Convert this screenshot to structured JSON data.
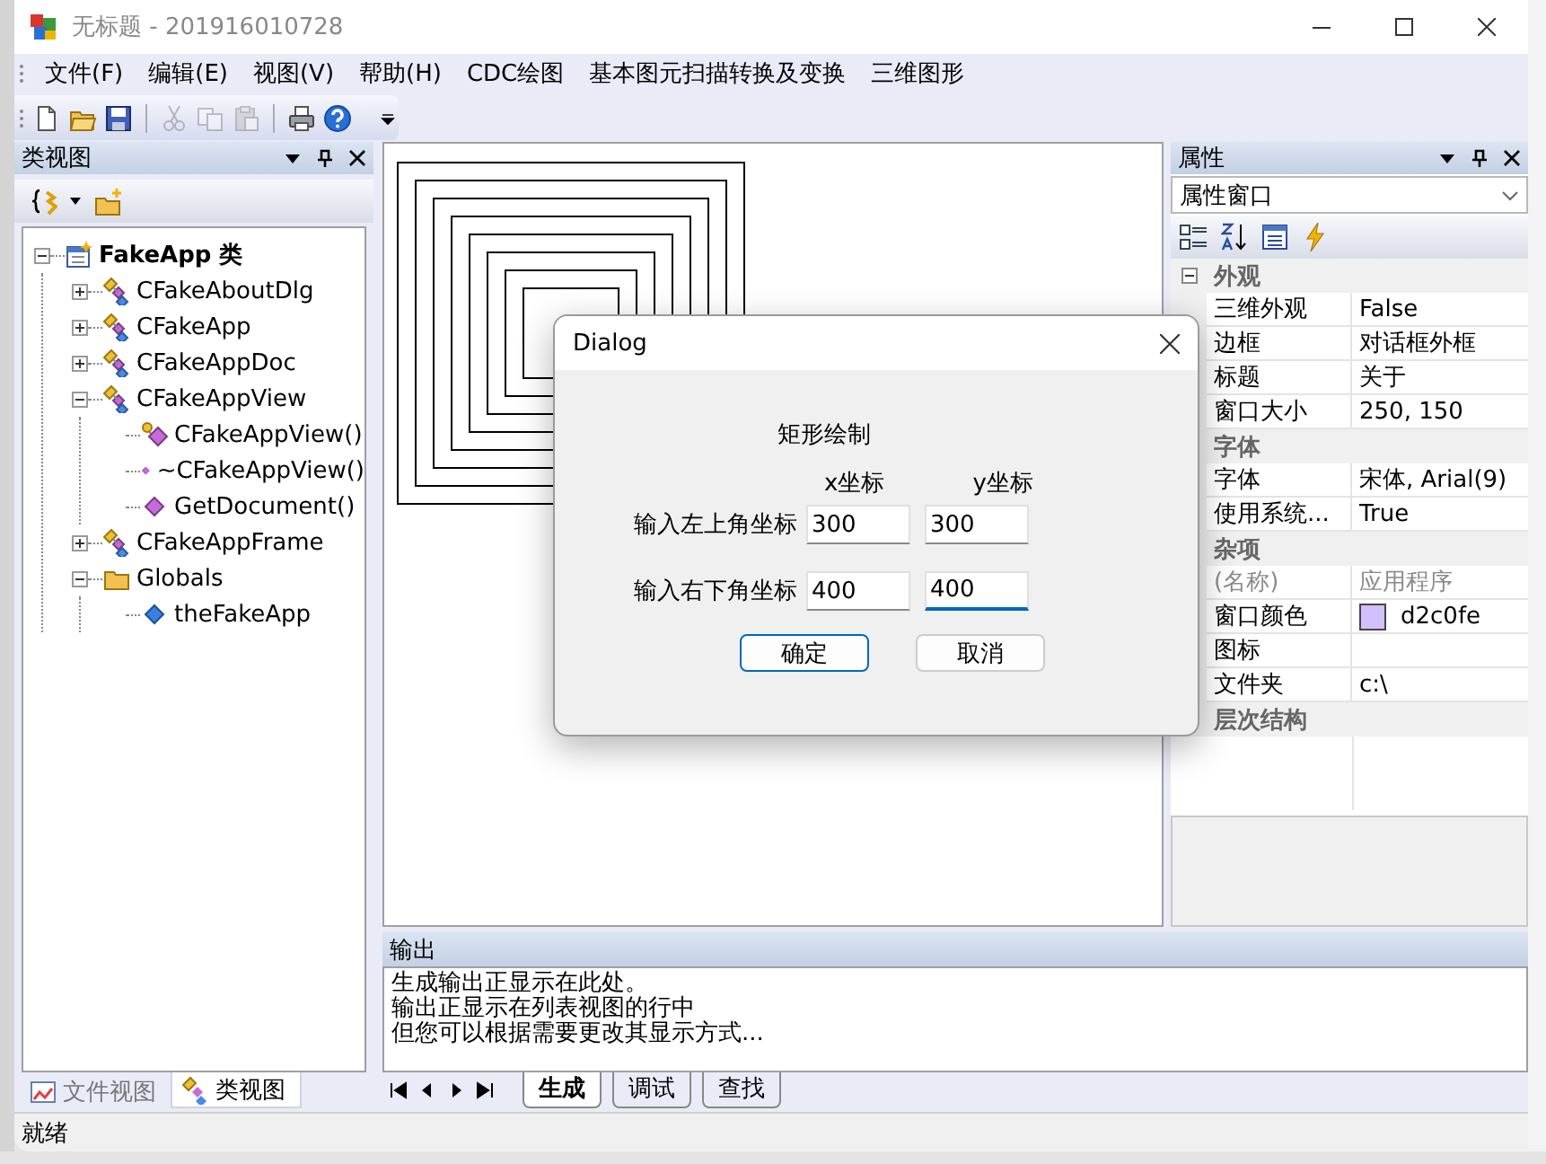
{
  "window": {
    "title": "无标题 - 201916010728"
  },
  "menu": [
    {
      "label": "文件(F)"
    },
    {
      "label": "编辑(E)"
    },
    {
      "label": "视图(V)"
    },
    {
      "label": "帮助(H)"
    },
    {
      "label": "CDC绘图"
    },
    {
      "label": "基本图元扫描转换及变换"
    },
    {
      "label": "三维图形"
    }
  ],
  "toolbar": [
    {
      "kind": "new",
      "disabled": false
    },
    {
      "kind": "open",
      "disabled": false
    },
    {
      "kind": "save",
      "disabled": false
    },
    {
      "kind": "separator"
    },
    {
      "kind": "cut",
      "disabled": true
    },
    {
      "kind": "copy",
      "disabled": true
    },
    {
      "kind": "paste",
      "disabled": true
    },
    {
      "kind": "separator"
    },
    {
      "kind": "print",
      "disabled": false
    },
    {
      "kind": "help",
      "disabled": false
    }
  ],
  "class_view": {
    "title": "类视图",
    "tree": [
      {
        "kind": "project",
        "label": "FakeApp 类",
        "expanded": true,
        "children": [
          {
            "kind": "class",
            "label": "CFakeAboutDlg",
            "expanded": false
          },
          {
            "kind": "class",
            "label": "CFakeApp",
            "expanded": false
          },
          {
            "kind": "class",
            "label": "CFakeAppDoc",
            "expanded": false
          },
          {
            "kind": "class",
            "label": "CFakeAppView",
            "expanded": true,
            "children": [
              {
                "kind": "constructor",
                "label": "CFakeAppView()"
              },
              {
                "kind": "method",
                "label": "~CFakeAppView()"
              },
              {
                "kind": "method",
                "label": "GetDocument()"
              }
            ]
          },
          {
            "kind": "class",
            "label": "CFakeAppFrame",
            "expanded": false
          },
          {
            "kind": "folder",
            "label": "Globals",
            "expanded": true,
            "children": [
              {
                "kind": "variable",
                "label": "theFakeApp"
              }
            ]
          }
        ]
      }
    ],
    "tabs": [
      {
        "label": "文件视图",
        "selected": false
      },
      {
        "label": "类视图",
        "selected": true
      }
    ]
  },
  "properties": {
    "title": "属性",
    "selector": "属性窗口",
    "groups": [
      {
        "name": "外观",
        "expanded": true,
        "rows": [
          {
            "name": "三维外观",
            "value": "False",
            "readonly": false
          },
          {
            "name": "边框",
            "value": "对话框外框",
            "readonly": false
          },
          {
            "name": "标题",
            "value": "关于",
            "readonly": false
          },
          {
            "name": "窗口大小",
            "value": "250, 150",
            "readonly": false
          }
        ]
      },
      {
        "name": "字体",
        "rows": [
          {
            "name": "字体",
            "value": "宋体, Arial(9)",
            "readonly": false
          },
          {
            "name": "使用系统...",
            "value": "True",
            "readonly": false
          }
        ]
      },
      {
        "name": "杂项",
        "rows": [
          {
            "name": "(名称)",
            "value": "应用程序",
            "readonly": true
          },
          {
            "name": "窗口颜色",
            "kind": "color",
            "value": "d2c0fe",
            "readonly": false
          },
          {
            "name": "图标",
            "readonly": false
          },
          {
            "name": "文件夹",
            "value": "c:\\",
            "readonly": false
          }
        ]
      },
      {
        "name": "层次结构"
      }
    ]
  },
  "dialog": {
    "title": "Dialog",
    "heading": "矩形绘制",
    "columns": [
      "x坐标",
      "y坐标"
    ],
    "rows": [
      {
        "label": "输入左上角坐标",
        "x": {
          "value": "300",
          "focused": false
        },
        "y": {
          "value": "300",
          "focused": false
        }
      },
      {
        "label": "输入右下角坐标",
        "x": {
          "value": "400",
          "focused": false
        },
        "y": {
          "value": "400",
          "focused": true
        }
      }
    ],
    "buttons": [
      {
        "label": "确定",
        "default": true
      },
      {
        "label": "取消",
        "default": false
      }
    ]
  },
  "output": {
    "title": "输出",
    "lines": [
      "生成输出正显示在此处。",
      "输出正显示在列表视图的行中",
      "但您可以根据需要更改其显示方式..."
    ],
    "tabs": [
      {
        "label": "生成",
        "selected": true
      },
      {
        "label": "调试",
        "selected": false
      },
      {
        "label": "查找",
        "selected": false
      }
    ]
  },
  "status_bar": "就绪"
}
